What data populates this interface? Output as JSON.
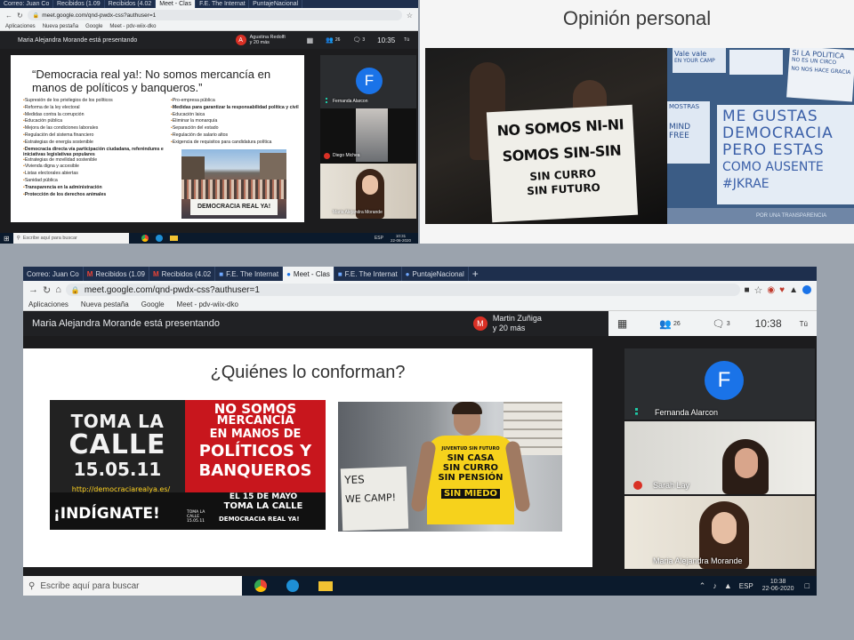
{
  "top_left": {
    "tabs": [
      "Correo: Juan Co",
      "Recibidos (1.09",
      "Recibidos (4.02",
      "Meet - Clas",
      "F.E. The Internat",
      "PuntajeNacional"
    ],
    "url": "meet.google.com/qnd-pwdx-css?authuser=1",
    "bookmarks": [
      "Aplicaciones",
      "Nueva pestaña",
      "Google",
      "Meet - pdv-wiix-dko"
    ],
    "presenting": "Maria Alejandra Morande está presentando",
    "host": "Agustina Redolfi\ny 20 más",
    "host_initial": "A",
    "participants": "26",
    "chat_count": "3",
    "clock": "10:35",
    "tu": "Tú",
    "slide_title": "“Democracia real ya!: No somos mercancía en manos de políticos y banqueros.”",
    "left_list": [
      "Supresión de los privilegios de los políticos",
      "Reforma de la ley electoral",
      "Medidas contra la corrupción",
      "Educación pública",
      "Mejora de las condiciones laborales",
      "Regulación del sistema financiero",
      "Estrategias de energía sostenible",
      "Democracia directa vía participación ciudadana, referéndums e iniciativas legislativas populares",
      "Estrategias de movilidad sostenible",
      "Vivienda digna y accesible",
      "Listas electorales abiertas",
      "Sanidad pública",
      "Transparencia en la administración",
      "Protección de los derechos animales"
    ],
    "right_list": [
      "Pro-empresa pública",
      "Medidas para garantizar la responsabilidad política y civil",
      "Educación laica",
      "Eliminar la monarquía",
      "Separación del estado",
      "Regulación de salario altos",
      "Exigencia de requisitos para candidatura política"
    ],
    "photo_banner": "DEMOCRACIA REAL YA!",
    "tile_fernanda": "Fernanda Alarcon",
    "tile_diego": "Diego Michea",
    "tile_maria": "Maria Alejandra Morande",
    "search_placeholder": "Escribe aquí para buscar",
    "tray_lang": "ESP",
    "tray_time": "10:31",
    "tray_date": "22-06-2020"
  },
  "top_right": {
    "title": "Opinión personal",
    "sign_lines": [
      "NO SOMOS NI-NI",
      "SOMOS SIN-SIN",
      "SIN CURRO",
      "SIN FUTURO"
    ],
    "notes": [
      "ME GUSTAS",
      "DEMOCRACIA",
      "PERO ESTAS",
      "COMO AUSENTE",
      "#JKRAE"
    ],
    "small_notes": [
      "Vale vale",
      "EN YOUR CAMP",
      "SI LA POLITICA",
      "NO ES UN CIRCO",
      "NO NOS HACE GRACIA",
      "MOSTRAS",
      "MIND FREE",
      "POR UNA TRANSPARENCIA"
    ]
  },
  "bottom": {
    "tabs": [
      "Correo: Juan Co",
      "Recibidos (1.09",
      "Recibidos (4.02",
      "F.E. The Internat",
      "Meet - Clas",
      "F.E. The Internat",
      "PuntajeNacional"
    ],
    "url": "meet.google.com/qnd-pwdx-css?authuser=1",
    "bookmarks": [
      "Aplicaciones",
      "Nueva pestaña",
      "Google",
      "Meet - pdv-wiix-dko"
    ],
    "presenting": "Maria Alejandra Morande está presentando",
    "host": "Martin Zuñiga\ny 20 más",
    "host_initial": "M",
    "participants": "26",
    "chat_count": "3",
    "clock": "10:38",
    "tu": "Tú",
    "slide_title": "¿Quiénes lo conforman?",
    "poster": {
      "toma1": "TOMA LA",
      "calle": "CALLE",
      "date": "15.05.11",
      "no_somos": "NO SOMOS",
      "mercancia": "MERCANCÍA",
      "en_manos": "EN MANOS DE",
      "politicos": "POLÍTICOS Y",
      "banqueros": "BANQUEROS",
      "url": "http://democraciarealya.es/",
      "may": "EL 15 DE MAYO",
      "toma2": "TOMA LA CALLE",
      "indignate": "¡INDÍGNATE!",
      "drya": "DEMOCRACIA REAL YA!",
      "mini": "TOMA LA CALLE 15.05.11"
    },
    "photo": {
      "shirt_top": "JUVENTUD SIN FUTURO",
      "shirt_lines": [
        "SIN CASA",
        "SIN CURRO",
        "SIN PENSIÓN",
        "SIN MIEDO"
      ],
      "sign_yes": "YES",
      "sign_camp": "WE CAMP!"
    },
    "tile_fernanda": "Fernanda Alarcon",
    "tile_sarah": "Sarah Lay",
    "tile_maria": "Maria Alejandra Morande",
    "search_placeholder": "Escribe aquí para buscar",
    "tray_lang": "ESP",
    "tray_time": "10:38",
    "tray_date": "22-06-2020"
  },
  "colors": {
    "meet_dark": "#202124",
    "tab_strip": "#1e2f4d",
    "avatar_blue": "#1a73e8",
    "host_red": "#d93025",
    "poster_red": "#c8161d",
    "shirt_yellow": "#f6d21c"
  }
}
